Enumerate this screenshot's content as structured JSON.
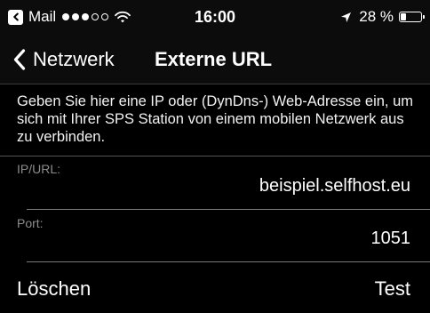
{
  "status_bar": {
    "app_name": "Mail",
    "time": "16:00",
    "battery_text": "28 %",
    "battery_level": 0.28,
    "signal_bars_filled": 3,
    "signal_bars_total": 5,
    "icons": [
      "back-to-app-icon",
      "signal-dots-icon",
      "wifi-icon",
      "location-arrow-icon",
      "battery-icon"
    ]
  },
  "nav": {
    "back_label": "Netzwerk",
    "title": "Externe URL"
  },
  "description": "Geben Sie hier eine IP oder (DynDns-) Web-Adresse ein, um sich mit Ihrer SPS Station von einem mobilen Netzwerk aus zu verbinden.",
  "fields": [
    {
      "label": "IP/URL:",
      "value": "beispiel.selfhost.eu"
    },
    {
      "label": "Port:",
      "value": "1051"
    }
  ],
  "actions": {
    "delete_label": "Löschen",
    "test_label": "Test"
  },
  "colors": {
    "background": "#000000",
    "text": "#ffffff",
    "label": "#8c8c8c"
  }
}
